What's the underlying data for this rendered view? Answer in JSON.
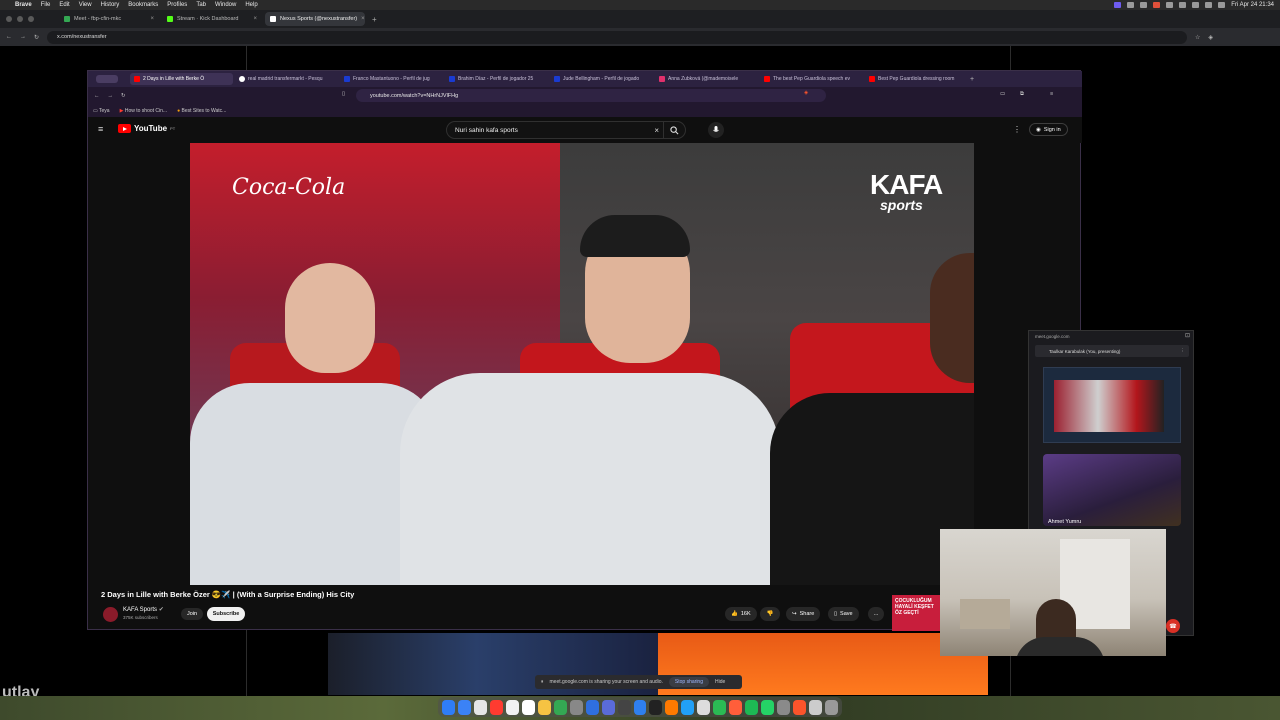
{
  "menubar": {
    "app": "Brave",
    "items": [
      "File",
      "Edit",
      "View",
      "History",
      "Bookmarks",
      "Profiles",
      "Tab",
      "Window",
      "Help"
    ],
    "datetime": "Fri Apr 24 21:34"
  },
  "outer_browser": {
    "tabs": [
      {
        "title": "Meet - fbp-cfin-mkc",
        "color": "#34a853"
      },
      {
        "title": "Stream · Kick Dashboard",
        "color": "#53fc18"
      },
      {
        "title": "Nexus Sports (@nexustransfer)",
        "color": "#ffffff"
      }
    ],
    "new_tab": "+",
    "url": "x.com/nexustransfer"
  },
  "background_page": {
    "big_text": "utlay"
  },
  "inner_browser": {
    "tabs": [
      {
        "title": "2 Days in Lille with Berke Ö",
        "color": "#ff0000"
      },
      {
        "title": "real madrid transfermarkt - Pesqu",
        "color": "#ffffff"
      },
      {
        "title": "Franco Mastantuono - Perfil de jug",
        "color": "#1a3bd1"
      },
      {
        "title": "Brahim Díaz - Perfil de jogador 25",
        "color": "#1a3bd1"
      },
      {
        "title": "Jude Bellingham - Perfil de jogado",
        "color": "#1a3bd1"
      },
      {
        "title": "Anna Zubková (@mademoisele",
        "color": "#e1306c"
      },
      {
        "title": "The best Pep Guardiola speech ev",
        "color": "#ff0000"
      },
      {
        "title": "Best Pep Guardiola dressing room",
        "color": "#ff0000"
      }
    ],
    "new_tab": "+",
    "url": "youtube.com/watch?v=NHrNJVlFHg",
    "bookmarks": [
      "Teya",
      "How to shoot Cin...",
      "Best Sites to Watc..."
    ]
  },
  "youtube": {
    "logo": "YouTube",
    "country": "PT",
    "search_value": "Nuri sahin kafa sports",
    "sign_in": "Sign in",
    "video_title": "2 Days in Lille with Berke Özer 😎✈️ | (With a Surprise Ending) His City",
    "channel_name": "KAFA Sports",
    "subscribers": "375K subscribers",
    "join": "Join",
    "subscribe": "Subscribe",
    "likes": "16K",
    "share": "Share",
    "save": "Save",
    "more": "...",
    "video_overlay": {
      "sponsor": "Coca-Cola",
      "brand_top": "KAFA",
      "brand_bottom": "sports"
    },
    "ad_text": "ÇOCUKLUĞUM HAYALİ KEŞFET ÖZ GEÇTİ"
  },
  "meet": {
    "url": "meet.google.com",
    "presenting": "Taulkar Karabulak (You, presenting)",
    "participant_name": "Ahmet Yumru"
  },
  "screenshare_bar": {
    "message": "meet.google.com is sharing your screen and audio.",
    "stop": "Stop sharing",
    "hide": "Hide"
  },
  "dock": {
    "icon_colors": [
      "#2f7df6",
      "#3b82f6",
      "#e6e6e6",
      "#ff3b30",
      "#f2f2f2",
      "#ffffff",
      "#f6c343",
      "#34a853",
      "#888888",
      "#2f6fe0",
      "#5a6bd8",
      "#444444",
      "#2f80ed",
      "#222222",
      "#ff7a00",
      "#21a0f6",
      "#dddddd",
      "#2bbb54",
      "#ff5e3a",
      "#1db954",
      "#25d366",
      "#8a8a8a",
      "#fb542b",
      "#cccccc",
      "#999999"
    ]
  }
}
